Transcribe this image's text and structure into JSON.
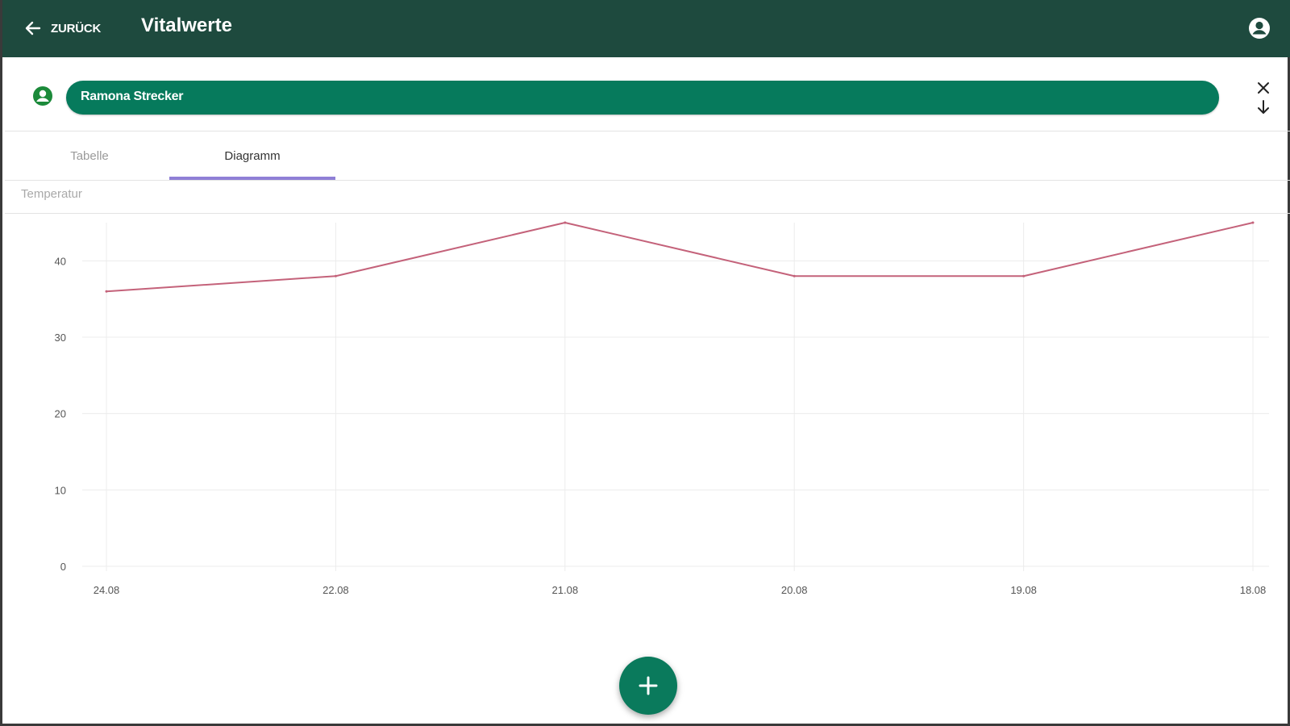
{
  "header": {
    "back_label": "ZURÜCK",
    "title": "Vitalwerte",
    "colors": {
      "bar": "#1e4a3e",
      "accent": "#067a5c"
    }
  },
  "patient": {
    "name": "Ramona Strecker"
  },
  "tabs": [
    {
      "label": "Tabelle",
      "active": false
    },
    {
      "label": "Diagramm",
      "active": true
    }
  ],
  "chart_label": "Temperatur",
  "chart_data": {
    "type": "line",
    "categories": [
      "24.08",
      "22.08",
      "21.08",
      "20.08",
      "19.08",
      "18.08"
    ],
    "series": [
      {
        "values": [
          36,
          38,
          45,
          38,
          38,
          45
        ],
        "color": "#c4627a"
      }
    ],
    "yticks": [
      0,
      10,
      20,
      30,
      40
    ],
    "ylim": [
      0,
      45
    ],
    "grid": true
  },
  "fab": {
    "icon": "plus-icon",
    "color": "#0a7a5c"
  }
}
